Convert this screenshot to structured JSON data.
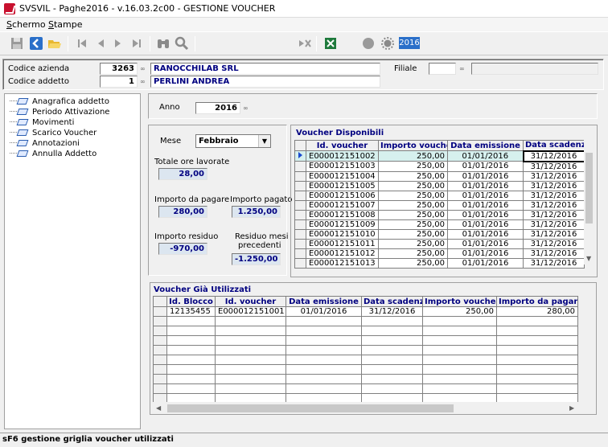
{
  "window": {
    "title": "SVSVIL - Paghe2016 - v.16.03.2c00 - GESTIONE VOUCHER"
  },
  "menu": {
    "items": [
      "Schermo",
      "Stampe"
    ]
  },
  "toolbar": {
    "year_badge": "2016"
  },
  "header": {
    "codice_azienda_label": "Codice azienda",
    "codice_azienda_value": "3263",
    "azienda_name": "RANOCCHILAB SRL",
    "codice_addetto_label": "Codice addetto",
    "codice_addetto_value": "1",
    "addetto_name": "PERLINI ANDREA",
    "filiale_label": "Filiale",
    "filiale_value": "",
    "filiale_desc": ""
  },
  "tree": {
    "items": [
      "Anagrafica addetto",
      "Periodo Attivazione",
      "Movimenti",
      "Scarico Voucher",
      "Annotazioni",
      "Annulla Addetto"
    ]
  },
  "main": {
    "anno_label": "Anno",
    "anno_value": "2016",
    "mese_label": "Mese",
    "mese_value": "Febbraio",
    "totale_ore_label": "Totale ore lavorate",
    "totale_ore_value": "28,00",
    "importo_da_pagare_label": "Importo da pagare",
    "importo_da_pagare_value": "280,00",
    "importo_pagato_label": "Importo pagato",
    "importo_pagato_value": "1.250,00",
    "importo_residuo_label": "Importo residuo",
    "importo_residuo_value": "-970,00",
    "residuo_mesi_label_1": "Residuo mesi",
    "residuo_mesi_label_2": "precedenti",
    "residuo_mesi_value": "-1.250,00"
  },
  "voucher_disponibili": {
    "title": "Voucher Disponibili",
    "columns": [
      "Id. voucher",
      "Importo voucher",
      "Data emissione",
      "Data scadenza"
    ],
    "rows": [
      [
        "E000012151002",
        "250,00",
        "01/01/2016",
        "31/12/2016"
      ],
      [
        "E000012151003",
        "250,00",
        "01/01/2016",
        "31/12/2016"
      ],
      [
        "E000012151004",
        "250,00",
        "01/01/2016",
        "31/12/2016"
      ],
      [
        "E000012151005",
        "250,00",
        "01/01/2016",
        "31/12/2016"
      ],
      [
        "E000012151006",
        "250,00",
        "01/01/2016",
        "31/12/2016"
      ],
      [
        "E000012151007",
        "250,00",
        "01/01/2016",
        "31/12/2016"
      ],
      [
        "E000012151008",
        "250,00",
        "01/01/2016",
        "31/12/2016"
      ],
      [
        "E000012151009",
        "250,00",
        "01/01/2016",
        "31/12/2016"
      ],
      [
        "E000012151010",
        "250,00",
        "01/01/2016",
        "31/12/2016"
      ],
      [
        "E000012151011",
        "250,00",
        "01/01/2016",
        "31/12/2016"
      ],
      [
        "E000012151012",
        "250,00",
        "01/01/2016",
        "31/12/2016"
      ],
      [
        "E000012151013",
        "250,00",
        "01/01/2016",
        "31/12/2016"
      ]
    ]
  },
  "voucher_utilizzati": {
    "title": "Voucher Già Utilizzati",
    "columns": [
      "Id. Blocco",
      "Id. voucher",
      "Data emissione",
      "Data scadenza",
      "Importo voucher",
      "Importo da pagare"
    ],
    "rows": [
      [
        "12135455",
        "E000012151001",
        "01/01/2016",
        "31/12/2016",
        "250,00",
        "280,00"
      ]
    ],
    "empty_rows": 9
  },
  "status": {
    "text": "sF6 gestione griglia voucher utilizzati"
  },
  "colors": {
    "accent": "#000080",
    "highlight_row": "#d6f0ee",
    "badge": "#2a6fc9"
  }
}
